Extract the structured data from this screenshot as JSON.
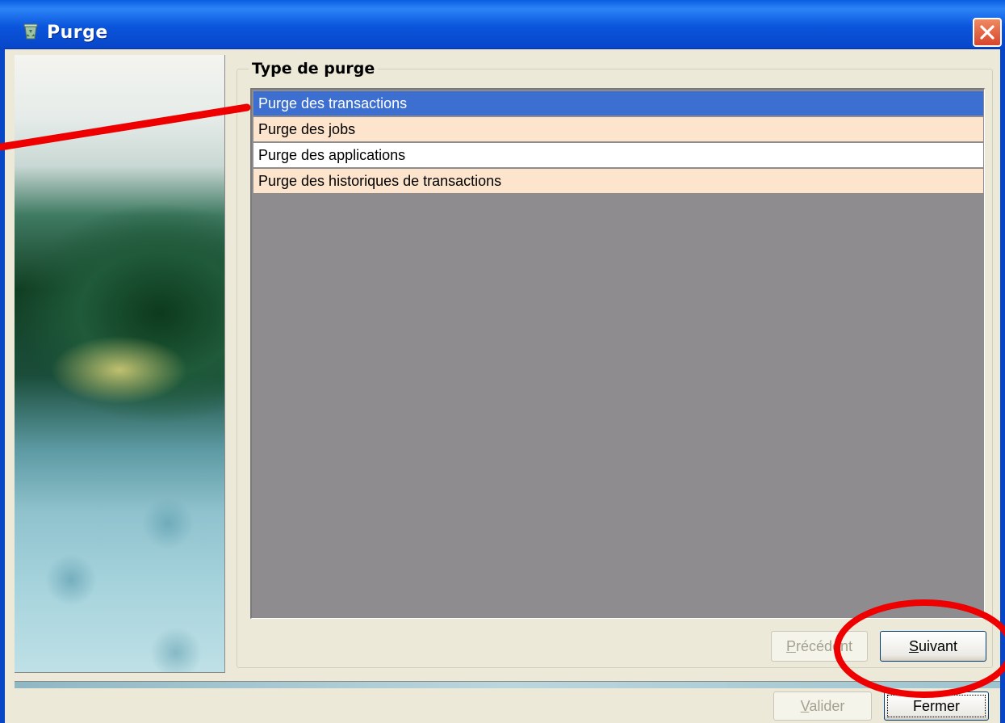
{
  "window": {
    "title": "Purge"
  },
  "group": {
    "label": "Type de purge"
  },
  "list": {
    "items": [
      {
        "label": "Purge des transactions",
        "state": "selected"
      },
      {
        "label": "Purge des jobs",
        "state": "peach"
      },
      {
        "label": "Purge des applications",
        "state": "white"
      },
      {
        "label": "Purge des historiques de transactions",
        "state": "peach"
      }
    ]
  },
  "buttons": {
    "previous": {
      "access_key": "P",
      "rest": "récédent"
    },
    "next": {
      "access_key": "S",
      "rest": "uivant"
    },
    "validate": {
      "access_key": "V",
      "rest": "alider"
    },
    "close": {
      "label": "Fermer"
    }
  },
  "colors": {
    "titlebar": "#0A55DC",
    "selection": "#3D6FD0",
    "row_alt": "#FDE4CC",
    "list_bg": "#8E8C8F",
    "annotation": "#EE0000"
  },
  "icons": {
    "title": "recycle-bin-icon",
    "close": "close-x-icon"
  }
}
